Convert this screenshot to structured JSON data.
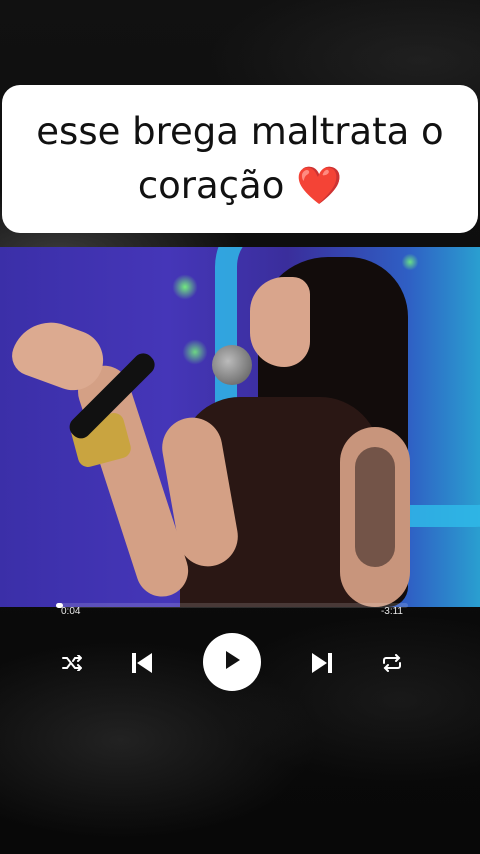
{
  "caption": {
    "text": "esse brega maltrata o coração",
    "emoji": "❤️"
  },
  "player": {
    "elapsed": "0:04",
    "remaining": "-3:11",
    "progress_fraction": 0.02,
    "icons": [
      "shuffle-icon",
      "previous-icon",
      "play-icon",
      "next-icon",
      "repeat-icon"
    ]
  }
}
